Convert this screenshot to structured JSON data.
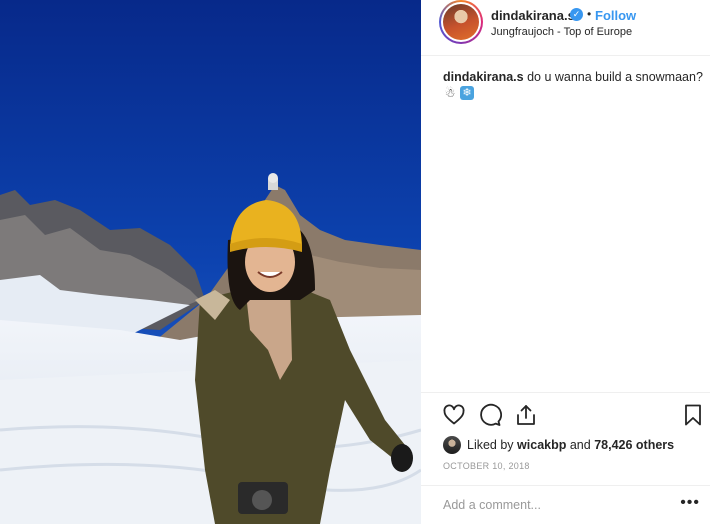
{
  "post": {
    "username": "dindakirana.s",
    "follow_label": "Follow",
    "location": "Jungfraujoch - Top of Europe",
    "caption_user": "dindakirana.s",
    "caption_text": "do u wanna build a snowmaan?",
    "caption_emojis": [
      "snowman-emoji",
      "snowflake-emoji"
    ],
    "liked_by_label": "Liked by",
    "liked_by_user": "wicakbp",
    "likes_and": "and",
    "likes_others": "78,426 others",
    "date": "OCTOBER 10, 2018",
    "comment_placeholder": "Add a comment...",
    "more_label": "•••"
  },
  "colors": {
    "accent": "#3897f0",
    "text": "#262626",
    "muted": "#999999",
    "sky": "#0c3fa8",
    "beanie": "#e9b21f",
    "jacket": "#4f4a2a"
  },
  "icons": [
    "heart-icon",
    "comment-icon",
    "share-icon",
    "bookmark-icon",
    "verified-badge-icon"
  ]
}
